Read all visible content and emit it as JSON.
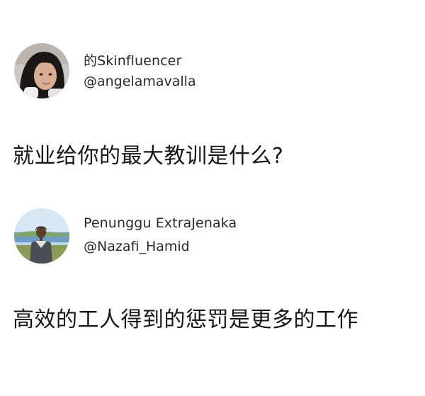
{
  "posts": [
    {
      "display_name": "的Skinfluencer",
      "handle": "@angelamavalla",
      "text": "就业给你的最大教训是什么?",
      "avatar_icon": "profile-photo-woman"
    },
    {
      "display_name": "Penunggu ExtraJenaka",
      "handle": "@Nazafi_Hamid",
      "text": "高效的工人得到的惩罚是更多的工作",
      "avatar_icon": "profile-photo-man-outdoors"
    }
  ],
  "colors": {
    "background": "#ffffff",
    "text": "#161616",
    "meta_text": "#2a2a2a"
  }
}
